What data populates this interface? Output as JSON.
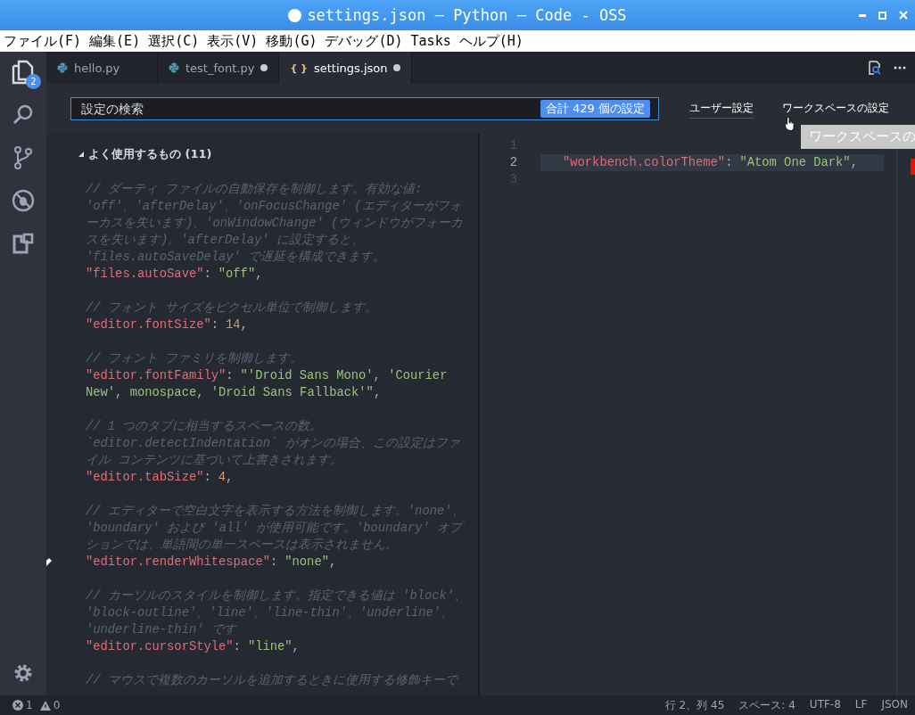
{
  "window": {
    "title": "settings.json — Python — Code - OSS"
  },
  "menu": [
    "ファイル(F)",
    "編集(E)",
    "選択(C)",
    "表示(V)",
    "移動(G)",
    "デバッグ(D)",
    "Tasks",
    "ヘルプ(H)"
  ],
  "activity_bar": {
    "explorer_badge": "2"
  },
  "tabs": [
    {
      "label": "hello.py",
      "kind": "python",
      "selected": false,
      "dirty": false
    },
    {
      "label": "test_font.py",
      "kind": "python",
      "selected": false,
      "dirty": true
    },
    {
      "label": "settings.json",
      "kind": "json",
      "glyph": "{ }",
      "selected": true,
      "dirty": true
    }
  ],
  "search": {
    "placeholder": "設定の検索",
    "count_badge": "合計 429 個の設定"
  },
  "scope_tabs": [
    {
      "label": "ユーザー設定",
      "selected": true
    },
    {
      "label": "ワークスペースの設定",
      "selected": false
    }
  ],
  "tooltip": "ワークスペースの",
  "default_settings": {
    "group_title": "よく使用するもの (11)",
    "expanded": true,
    "entries": [
      {
        "comment": [
          "// ダーティ ファイルの自動保存を制御します。有効な値:",
          "'off'、'afterDelay'、'onFocusChange' (エディターがフォ",
          "ーカスを失います)、'onWindowChange' (ウィンドウがフォーカ",
          "スを失います)。'afterDelay' に設定すると、",
          "'files.autoSaveDelay' で遅延を構成できます。"
        ],
        "code": [
          [
            {
              "kind": "key",
              "text": "\"files.autoSave\""
            },
            {
              "kind": "punct",
              "text": ":"
            },
            {
              "kind": "string",
              "text": "\"off\""
            },
            {
              "kind": "punct",
              "text": ","
            }
          ]
        ]
      },
      {
        "comment": [
          "// フォント サイズをピクセル単位で制御します。"
        ],
        "code": [
          [
            {
              "kind": "key",
              "text": "\"editor.fontSize\""
            },
            {
              "kind": "punct",
              "text": ":"
            },
            {
              "kind": "number",
              "text": "14"
            },
            {
              "kind": "punct",
              "text": ","
            }
          ]
        ]
      },
      {
        "comment": [
          "// フォント ファミリを制御します。"
        ],
        "code": [
          [
            {
              "kind": "key",
              "text": "\"editor.fontFamily\""
            },
            {
              "kind": "punct",
              "text": ":"
            },
            {
              "kind": "string",
              "text": "\"'Droid Sans Mono', 'Courier"
            }
          ],
          [
            {
              "kind": "string",
              "text": "New', monospace, 'Droid Sans Fallback'\""
            },
            {
              "kind": "punct",
              "text": ","
            }
          ]
        ]
      },
      {
        "comment": [
          "// 1 つのタブに相当するスペースの数。",
          "`editor.detectIndentation` がオンの場合、この設定はファ",
          "イル コンテンツに基づいて上書きされます。"
        ],
        "code": [
          [
            {
              "kind": "key",
              "text": "\"editor.tabSize\""
            },
            {
              "kind": "punct",
              "text": ":"
            },
            {
              "kind": "number",
              "text": "4"
            },
            {
              "kind": "punct",
              "text": ","
            }
          ]
        ]
      },
      {
        "comment": [
          "// エディターで空白文字を表示する方法を制御します。'none'、",
          "'boundary' および 'all' が使用可能です。'boundary' オプ",
          "ションでは、単語間の単一スペースは表示されません。"
        ],
        "edit_marker": true,
        "code": [
          [
            {
              "kind": "key",
              "text": "\"editor.renderWhitespace\""
            },
            {
              "kind": "punct",
              "text": ":"
            },
            {
              "kind": "string",
              "text": "\"none\""
            },
            {
              "kind": "punct",
              "text": ","
            }
          ]
        ]
      },
      {
        "comment": [
          "// カーソルのスタイルを制御します。指定できる値は 'block'、",
          "'block-outline'、'line'、'line-thin'、'underline'、",
          "'underline-thin' です"
        ],
        "code": [
          [
            {
              "kind": "key",
              "text": "\"editor.cursorStyle\""
            },
            {
              "kind": "punct",
              "text": ":"
            },
            {
              "kind": "string",
              "text": "\"line\""
            },
            {
              "kind": "punct",
              "text": ","
            }
          ]
        ]
      },
      {
        "comment": [
          "// マウスで複数のカーソルを追加するときに使用する修飾キーで"
        ]
      }
    ]
  },
  "editor": {
    "lines": [
      {
        "number": "1",
        "selected": false
      },
      {
        "number": "2",
        "selected": true,
        "code": [
          {
            "kind": "key",
            "text": "\"workbench.colorTheme\""
          },
          {
            "kind": "punct",
            "text": ":"
          },
          {
            "kind": "string",
            "text": "\"Atom One Dark\""
          },
          {
            "kind": "punct",
            "text": ","
          }
        ]
      },
      {
        "number": "3",
        "selected": false
      }
    ]
  },
  "status_bar": {
    "errors": "1",
    "warnings": "0",
    "items": [
      "行 2、列 45",
      "スペース: 4",
      "UTF-8",
      "LF",
      "JSON"
    ]
  }
}
